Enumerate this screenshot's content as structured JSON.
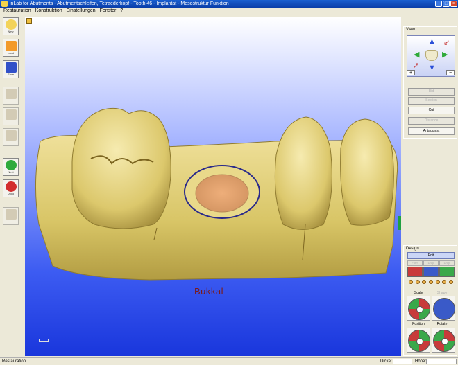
{
  "window": {
    "title": "inLab for Abutments - Abutmentschleifen, Tetraederkopf - Tooth 46 - Implantat - Mesostruktur Funktion",
    "min": "_",
    "max": "□",
    "close": "×"
  },
  "menu": [
    "Restauration",
    "Konstruktion",
    "Einstellungen",
    "Fenster",
    "?"
  ],
  "toolbar": [
    {
      "label": "New",
      "icon": "new-icon",
      "color": "#f3d35a",
      "enabled": true
    },
    {
      "label": "Load",
      "icon": "load-folder-icon",
      "color": "#f29a2a",
      "enabled": true
    },
    {
      "label": "Save",
      "icon": "save-disk-icon",
      "color": "#3150c8",
      "enabled": true
    },
    {
      "label": "",
      "icon": "restore-tooth-icon",
      "color": "#c0b49a",
      "enabled": false
    },
    {
      "label": "",
      "icon": "edit-tooth-icon",
      "color": "#c0b49a",
      "enabled": false
    },
    {
      "label": "",
      "icon": "design-tooth-icon",
      "color": "#c0b49a",
      "enabled": false
    },
    {
      "label": "Next",
      "icon": "next-arrow-icon",
      "color": "#2eaa3d",
      "enabled": true
    },
    {
      "label": "Undo",
      "icon": "undo-arrow-icon",
      "color": "#d22d2d",
      "enabled": true
    },
    {
      "label": "",
      "icon": "export-icon",
      "color": "#c0b49a",
      "enabled": false
    }
  ],
  "viewport": {
    "annotation": "Bukkal"
  },
  "view_panel": {
    "title": "View",
    "zoom_in": "+",
    "zoom_out": "−",
    "buttons": [
      {
        "label": "Bid",
        "enabled": false
      },
      {
        "label": "Section",
        "enabled": false
      },
      {
        "label": "Cut",
        "enabled": true
      },
      {
        "label": "Distance",
        "enabled": false
      },
      {
        "label": "Antagonist",
        "enabled": true
      }
    ]
  },
  "design_panel": {
    "title": "Design",
    "edit": "Edit",
    "tabs": [
      "Form",
      "Drop",
      "Drop"
    ],
    "scale": "Scale",
    "shape": "Shape",
    "position": "Position",
    "rotate": "Rotate"
  },
  "statusbar": {
    "left": "Restauration",
    "dicke_label": "Dicke:",
    "hoehe_label": "Höhe:"
  },
  "colors": {
    "model": "#e6d27a",
    "prep_margin": "#2a2a8a",
    "background_top": "#ffffff",
    "background_bottom": "#1936dc"
  }
}
